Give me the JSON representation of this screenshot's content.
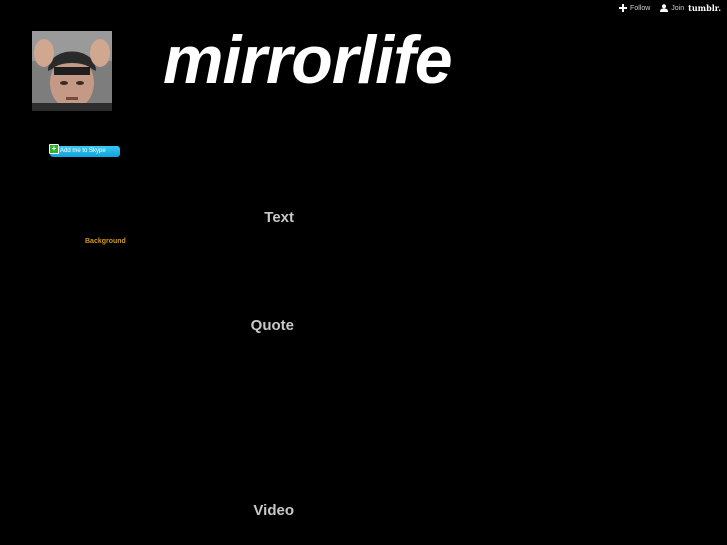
{
  "tumblr_controls": {
    "follow_label": "Follow",
    "join_label": "Join",
    "brand": "tumblr."
  },
  "header": {
    "title": "mirrorlife"
  },
  "sidebar": {
    "skype_label": "Add me to Skype",
    "background_link": "Background"
  },
  "posts": [
    {
      "type_label": "Text"
    },
    {
      "type_label": "Quote"
    },
    {
      "type_label": "Video"
    }
  ],
  "colors": {
    "background": "#000000",
    "title": "#ffffff",
    "heading": "#c8c8c8",
    "link_accent": "#d49a1c",
    "skype_blue": "#10a2dc"
  }
}
